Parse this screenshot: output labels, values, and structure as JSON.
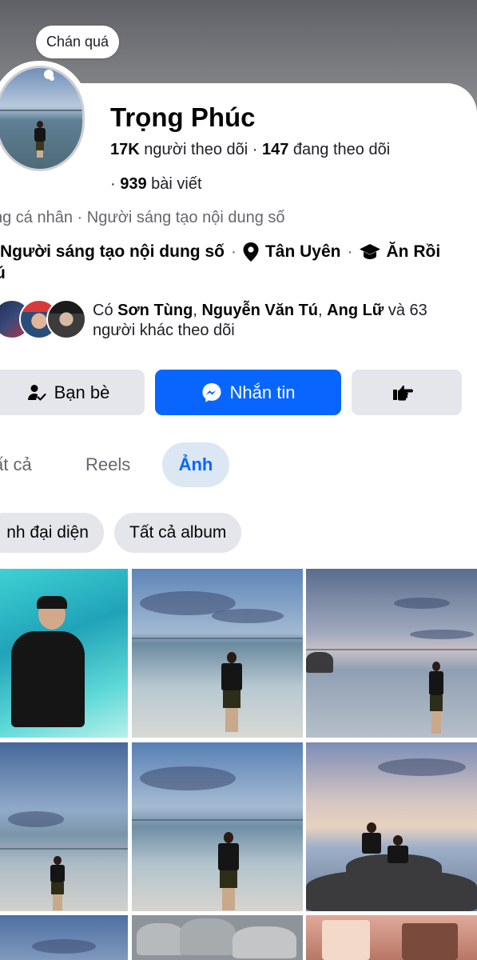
{
  "profile": {
    "note": "Chán quá",
    "name": "Trọng Phúc",
    "followers_count": "17K",
    "followers_label": "người theo dõi",
    "following_count": "147",
    "following_label": "đang theo dõi",
    "posts_count": "939",
    "posts_label": "bài viết",
    "category_line": "ng cá nhân · Người sáng tạo nội dung số",
    "info_creator": "Người sáng tạo nội dung số",
    "info_location": "Tân Uyên",
    "info_education": "Ăn Rồi",
    "info_overflow": "ú",
    "mutual_prefix": "Có ",
    "mutual_names": [
      "Sơn Tùng",
      "Nguyễn Văn Tú",
      "Ang Lữ"
    ],
    "mutual_suffix": " và 63 người khác theo dõi"
  },
  "actions": {
    "friends_label": "Bạn bè",
    "message_label": "Nhắn tin"
  },
  "tabs": [
    {
      "label": "ất cả",
      "active": false
    },
    {
      "label": "Reels",
      "active": false
    },
    {
      "label": "Ảnh",
      "active": true
    }
  ],
  "chips": {
    "avatar_album": "nh đại diện",
    "all_albums": "Tất cả album"
  },
  "colors": {
    "accent": "#0866ff",
    "button_gray": "#e4e6eb",
    "active_tab_bg": "#dbe7f2",
    "secondary_text": "#65676b"
  },
  "icons": {
    "friends": "person-check-icon",
    "messenger": "messenger-icon",
    "more": "pointing-hand-icon",
    "location": "map-pin-icon",
    "education": "graduation-cap-icon"
  }
}
